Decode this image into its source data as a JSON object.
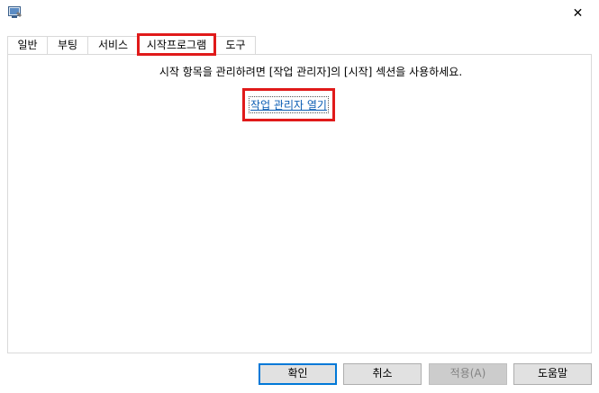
{
  "window": {
    "icon": "system-config-icon",
    "close_glyph": "✕"
  },
  "tabs": [
    {
      "label": "일반",
      "active": false
    },
    {
      "label": "부팅",
      "active": false
    },
    {
      "label": "서비스",
      "active": false
    },
    {
      "label": "시작프로그램",
      "active": true
    },
    {
      "label": "도구",
      "active": false
    }
  ],
  "startup": {
    "message": "시작 항목을 관리하려면 [작업 관리자]의 [시작] 섹션을 사용하세요.",
    "link_label": "작업 관리자 열기"
  },
  "buttons": {
    "ok": "확인",
    "cancel": "취소",
    "apply": "적용(A)",
    "help": "도움말"
  },
  "colors": {
    "highlight": "#e01a1a",
    "link": "#0a5cb3",
    "default_button_border": "#0078d7"
  }
}
